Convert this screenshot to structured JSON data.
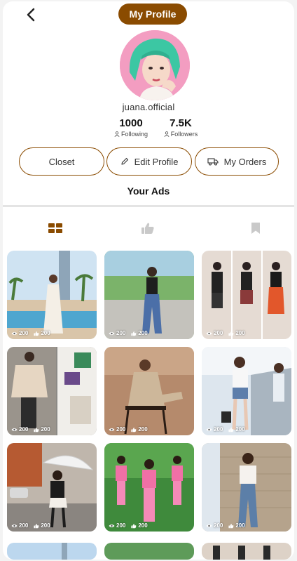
{
  "header": {
    "title": "My Profile"
  },
  "profile": {
    "username": "juana.official",
    "following_count": "1000",
    "following_label": "Following",
    "followers_count": "7.5K",
    "followers_label": "Followers"
  },
  "actions": {
    "closet_label": "Closet",
    "edit_label": "Edit Profile",
    "orders_label": "My Orders"
  },
  "section": {
    "title": "Your Ads"
  },
  "tabs": [
    {
      "icon": "grid-icon",
      "active": true
    },
    {
      "icon": "thumbs-up-icon",
      "active": false
    },
    {
      "icon": "bookmark-icon",
      "active": false
    }
  ],
  "colors": {
    "accent": "#8a4b00",
    "inactive_icon": "#c9c9c9"
  },
  "ads": [
    {
      "views": "200",
      "likes": "200",
      "scene": "white-dress-pool"
    },
    {
      "views": "200",
      "likes": "200",
      "scene": "black-top-jeans-park"
    },
    {
      "views": "200",
      "likes": "200",
      "scene": "three-black-outfits"
    },
    {
      "views": "200",
      "likes": "200",
      "scene": "beige-sweater-flatlay"
    },
    {
      "views": "200",
      "likes": "200",
      "scene": "beige-suit-chair"
    },
    {
      "views": "200",
      "likes": "200",
      "scene": "white-top-denim-shorts"
    },
    {
      "views": "200",
      "likes": "200",
      "scene": "umbrella-street-autumn"
    },
    {
      "views": "200",
      "likes": "200",
      "scene": "pink-outfits-trio"
    },
    {
      "views": "200",
      "likes": "200",
      "scene": "white-blouse-jeans-wall"
    }
  ]
}
